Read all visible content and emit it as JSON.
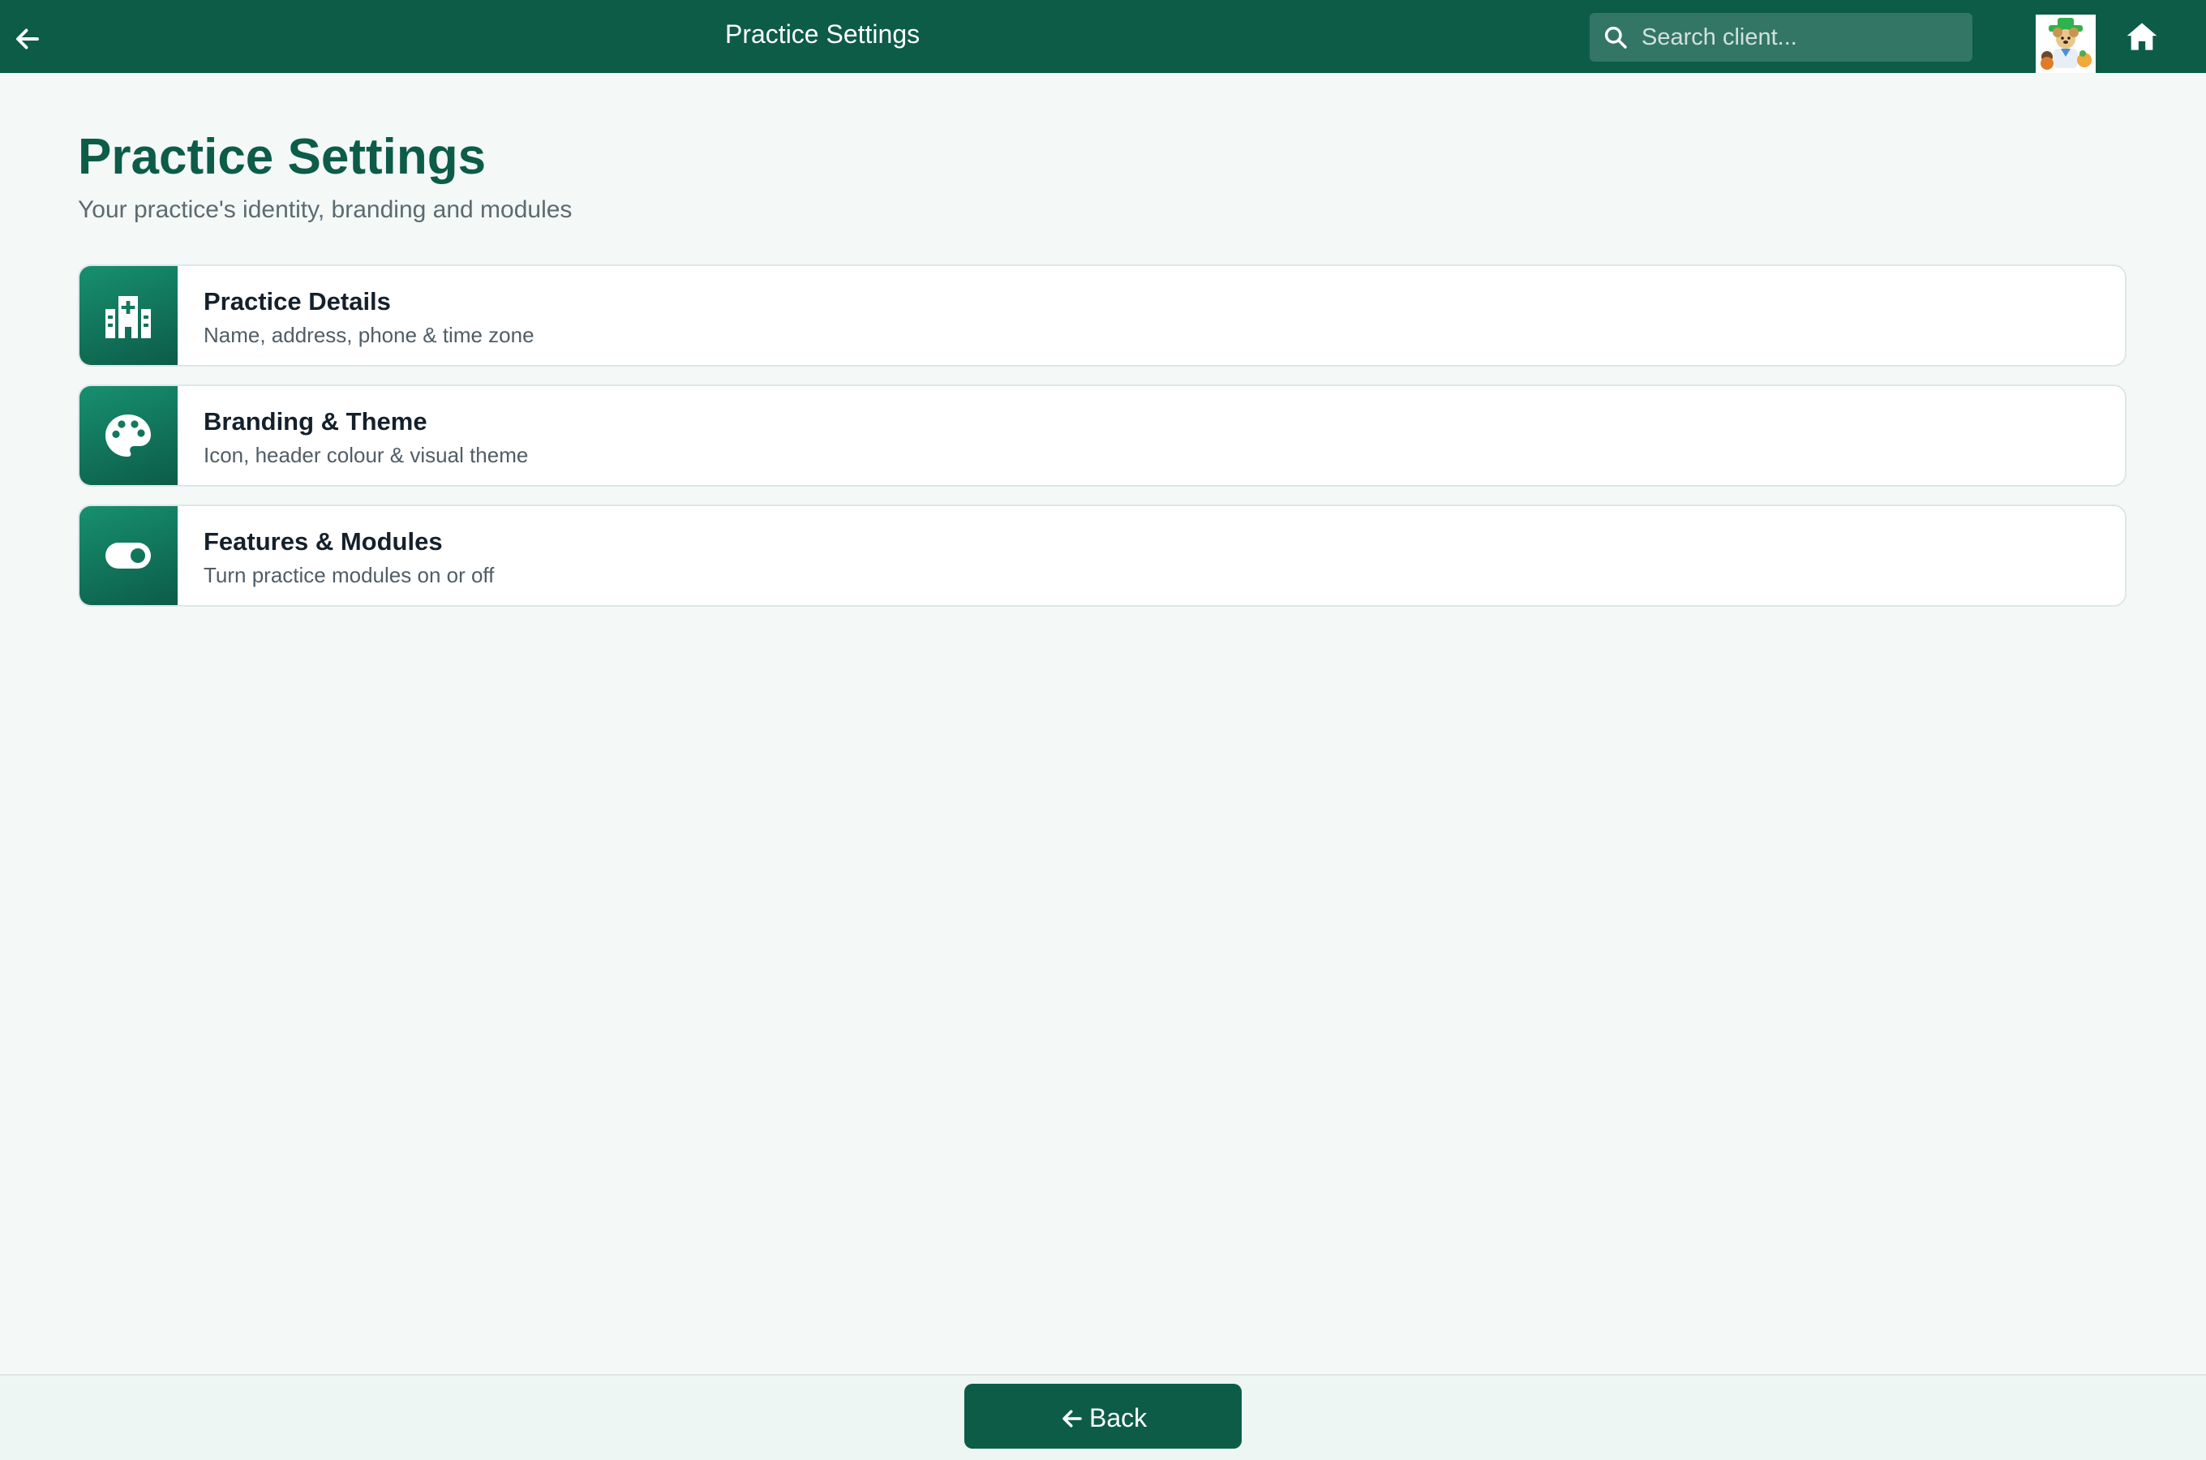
{
  "header": {
    "title": "Practice Settings",
    "search_placeholder": "Search client...",
    "back_icon": "arrow-left-icon",
    "search_icon": "search-icon",
    "home_icon": "home-icon",
    "avatar": "practice-logo"
  },
  "main": {
    "title": "Practice Settings",
    "subtitle": "Your practice's identity, branding and modules",
    "cards": [
      {
        "title": "Practice Details",
        "description": "Name, address, phone & time zone",
        "icon": "hospital-icon"
      },
      {
        "title": "Branding & Theme",
        "description": "Icon, header colour & visual theme",
        "icon": "palette-icon"
      },
      {
        "title": "Features & Modules",
        "description": "Turn practice modules on or off",
        "icon": "toggle-icon"
      }
    ]
  },
  "footer": {
    "back_label": "Back"
  },
  "colors": {
    "header_bg": "#0c5c48",
    "accent": "#0c5c48",
    "icon_gradient_light": "#17906f",
    "page_bg": "#f4f8f7"
  }
}
